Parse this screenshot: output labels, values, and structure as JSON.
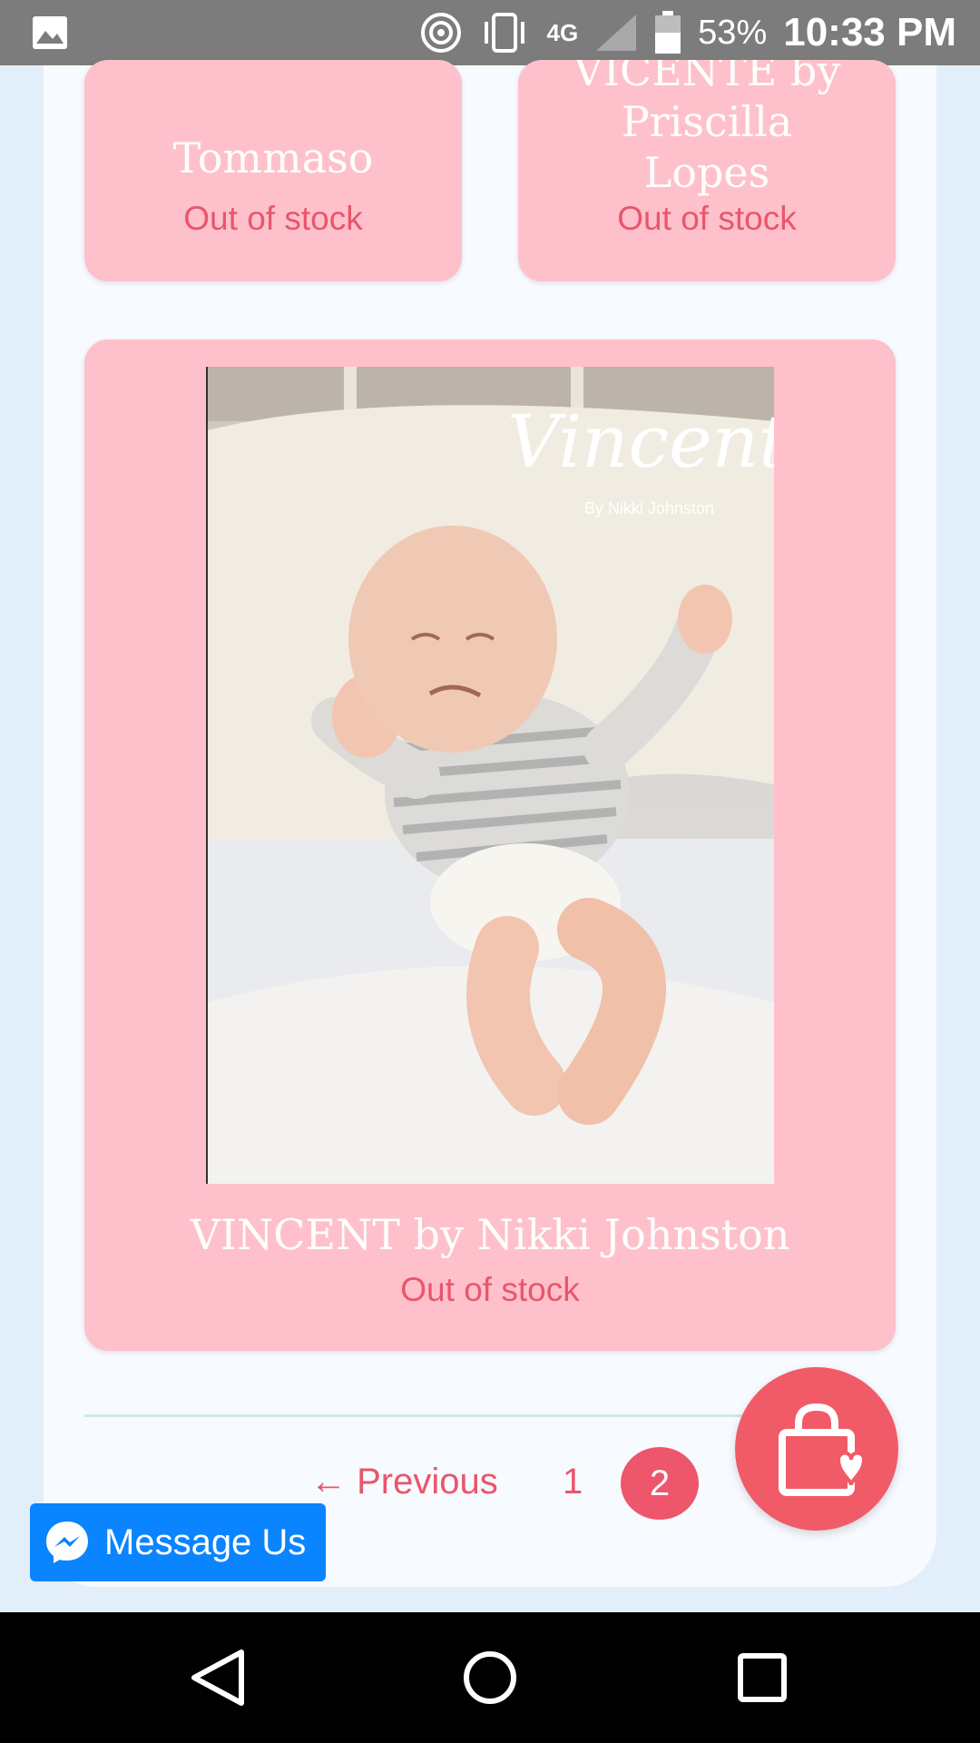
{
  "status_bar": {
    "battery_percent": "53%",
    "time": "10:33 PM",
    "network": "4G",
    "icons": [
      "gallery-icon",
      "hotspot-icon",
      "vibrate-icon",
      "network-4g-icon",
      "signal-icon",
      "battery-icon"
    ]
  },
  "products": [
    {
      "title": "Tommaso",
      "stock": "Out of stock"
    },
    {
      "title_lines": [
        "VICENTE by",
        "Priscilla",
        "Lopes"
      ],
      "stock": "Out of stock"
    },
    {
      "title": "VINCENT by Nikki Johnston",
      "stock": "Out of stock",
      "image_overlay": {
        "script": "Vincent",
        "sub": "By Nikki Johnston"
      }
    }
  ],
  "pagination": {
    "previous": "← Previous",
    "pages": [
      "1",
      "2"
    ],
    "current": "2"
  },
  "cart_fab": {
    "icon": "shopping-bag-heart-icon"
  },
  "messenger": {
    "label": "Message Us",
    "icon": "messenger-icon"
  },
  "colors": {
    "card_bg": "#fec1cb",
    "accent": "#e9566c",
    "fab": "#f15b67",
    "messenger": "#0a84ff"
  }
}
